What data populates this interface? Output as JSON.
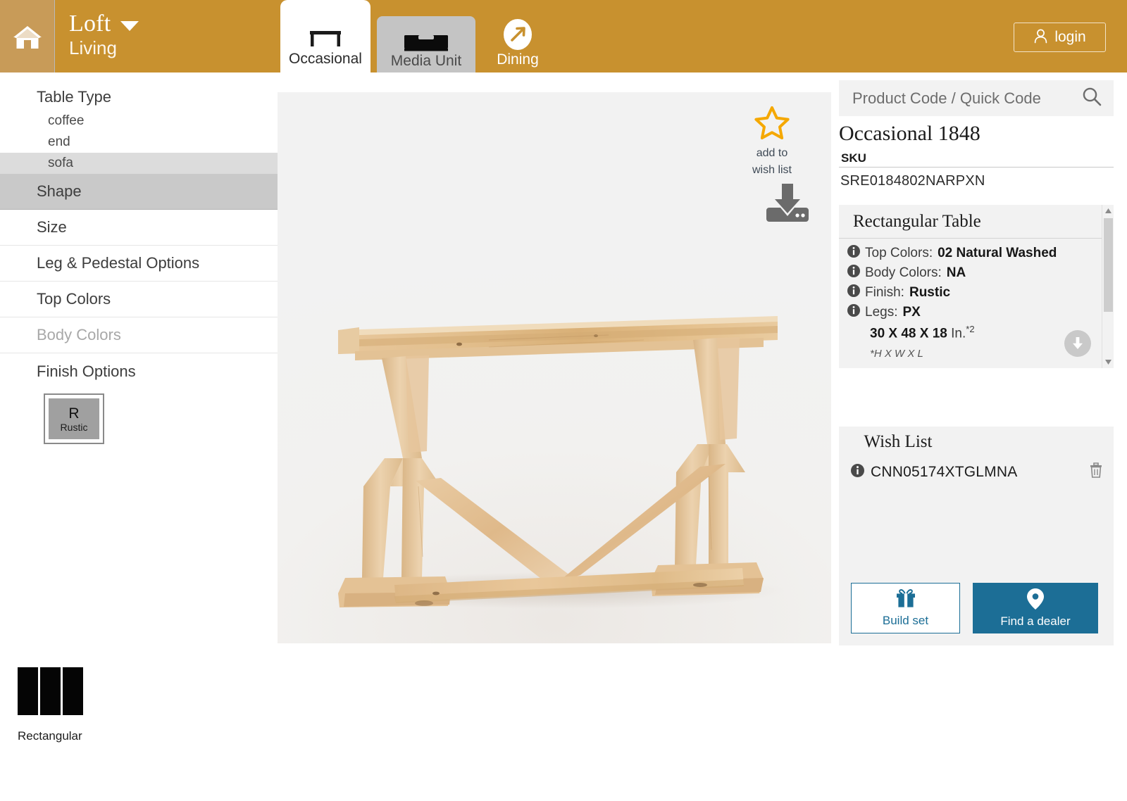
{
  "header": {
    "home_icon": "home-icon",
    "brand_name": "Loft",
    "brand_caret_icon": "chevron-down-icon",
    "brand_sub": "Living",
    "login_label": "login",
    "login_icon": "user-icon",
    "gold": "#c8912f",
    "gold_light": "#c89b58",
    "tabs": [
      {
        "label": "Occasional",
        "icon": "occasional-table-icon",
        "active": true
      },
      {
        "label": "Media Unit",
        "icon": "media-unit-icon",
        "active": false
      },
      {
        "label": "Dining",
        "icon": "dining-arrow-icon",
        "active": false
      }
    ]
  },
  "sidebar": {
    "table_type_title": "Table Type",
    "table_types": [
      {
        "label": "coffee",
        "selected": false
      },
      {
        "label": "end",
        "selected": false
      },
      {
        "label": "sofa",
        "selected": true
      }
    ],
    "rows": [
      {
        "label": "Shape",
        "state": "active"
      },
      {
        "label": "Size",
        "state": "normal"
      },
      {
        "label": "Leg & Pedestal Options",
        "state": "normal"
      },
      {
        "label": "Top Colors",
        "state": "normal"
      },
      {
        "label": "Body Colors",
        "state": "disabled"
      }
    ],
    "finish_title": "Finish Options",
    "finish_swatch": {
      "letter": "R",
      "name": "Rustic"
    },
    "shape": {
      "icon": "rectangular-shape-icon",
      "label": "Rectangular"
    }
  },
  "stage": {
    "wish_cta_icon": "star-outline-icon",
    "wish_cta_line1": "add to",
    "wish_cta_line2": "wish list",
    "wish_star_color": "#f5a800",
    "download_icon": "download-icon",
    "product_image_alt": "rustic natural washed rectangular sofa table"
  },
  "right": {
    "search_placeholder": "Product Code / Quick Code",
    "search_value": "",
    "search_icon": "search-icon",
    "product_title": "Occasional 1848",
    "sku_label": "SKU",
    "sku_value": "SRE0184802NARPXN",
    "detail_card": {
      "heading": "Rectangular Table",
      "info_icon": "info-icon",
      "lines": [
        {
          "label": "Top Colors:",
          "value": "02 Natural Washed"
        },
        {
          "label": "Body Colors:",
          "value": "NA"
        },
        {
          "label": "Finish:",
          "value": "Rustic"
        },
        {
          "label": "Legs:",
          "value": "PX"
        }
      ],
      "dimensions": {
        "value": "30 X 48 X 18",
        "unit": "In.",
        "note": "*2"
      },
      "footnote": "*H X W X L",
      "scroll_up_icon": "scroll-up-arrow-icon",
      "scroll_down_icon": "scroll-down-arrow-icon",
      "scroll_more_icon": "scroll-more-down-icon"
    },
    "wish_list": {
      "title": "Wish List",
      "items": [
        {
          "info_icon": "info-icon",
          "code": "CNN05174XTGLMNA",
          "delete_icon": "trash-icon"
        }
      ],
      "build_set": {
        "label": "Build set",
        "icon": "gift-icon"
      },
      "find_dealer": {
        "label": "Find a dealer",
        "icon": "map-pin-icon"
      },
      "accent": "#1c6e96"
    }
  }
}
